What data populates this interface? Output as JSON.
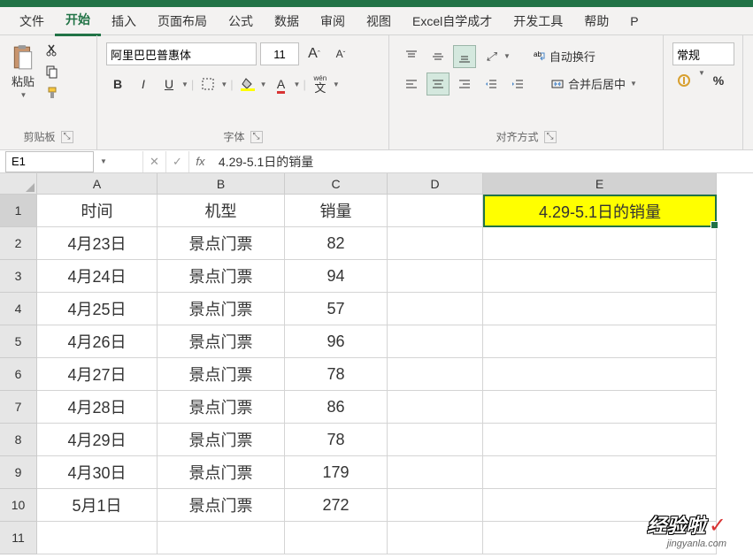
{
  "tabs": {
    "file": "文件",
    "home": "开始",
    "insert": "插入",
    "pagelayout": "页面布局",
    "formulas": "公式",
    "data": "数据",
    "review": "审阅",
    "view": "视图",
    "excel_self": "Excel自学成才",
    "developer": "开发工具",
    "help": "帮助",
    "p": "P"
  },
  "ribbon": {
    "clipboard": {
      "paste": "粘贴",
      "label": "剪贴板"
    },
    "font": {
      "name": "阿里巴巴普惠体",
      "size": "11",
      "wen": "wén",
      "wenchar": "文",
      "label": "字体"
    },
    "align": {
      "wrap": "自动换行",
      "merge": "合并后居中",
      "label": "对齐方式"
    },
    "number": {
      "general": "常规"
    }
  },
  "formula_bar": {
    "cell_ref": "E1",
    "value": "4.29-5.1日的销量"
  },
  "columns": [
    "A",
    "B",
    "C",
    "D",
    "E"
  ],
  "rows": [
    "1",
    "2",
    "3",
    "4",
    "5",
    "6",
    "7",
    "8",
    "9",
    "10",
    "11"
  ],
  "headers": {
    "a": "时间",
    "b": "机型",
    "c": "销量"
  },
  "data_rows": [
    {
      "a": "4月23日",
      "b": "景点门票",
      "c": "82"
    },
    {
      "a": "4月24日",
      "b": "景点门票",
      "c": "94"
    },
    {
      "a": "4月25日",
      "b": "景点门票",
      "c": "57"
    },
    {
      "a": "4月26日",
      "b": "景点门票",
      "c": "96"
    },
    {
      "a": "4月27日",
      "b": "景点门票",
      "c": "78"
    },
    {
      "a": "4月28日",
      "b": "景点门票",
      "c": "86"
    },
    {
      "a": "4月29日",
      "b": "景点门票",
      "c": "78"
    },
    {
      "a": "4月30日",
      "b": "景点门票",
      "c": "179"
    },
    {
      "a": "5月1日",
      "b": "景点门票",
      "c": "272"
    }
  ],
  "selected_cell": {
    "value": "4.29-5.1日的销量"
  },
  "watermark": {
    "main": "经验啦",
    "check": "✓",
    "sub": "jingyanla.com"
  },
  "chart_data": {
    "type": "table",
    "title": "4.29-5.1日的销量",
    "columns": [
      "时间",
      "机型",
      "销量"
    ],
    "rows": [
      [
        "4月23日",
        "景点门票",
        82
      ],
      [
        "4月24日",
        "景点门票",
        94
      ],
      [
        "4月25日",
        "景点门票",
        57
      ],
      [
        "4月26日",
        "景点门票",
        96
      ],
      [
        "4月27日",
        "景点门票",
        78
      ],
      [
        "4月28日",
        "景点门票",
        86
      ],
      [
        "4月29日",
        "景点门票",
        78
      ],
      [
        "4月30日",
        "景点门票",
        179
      ],
      [
        "5月1日",
        "景点门票",
        272
      ]
    ]
  }
}
